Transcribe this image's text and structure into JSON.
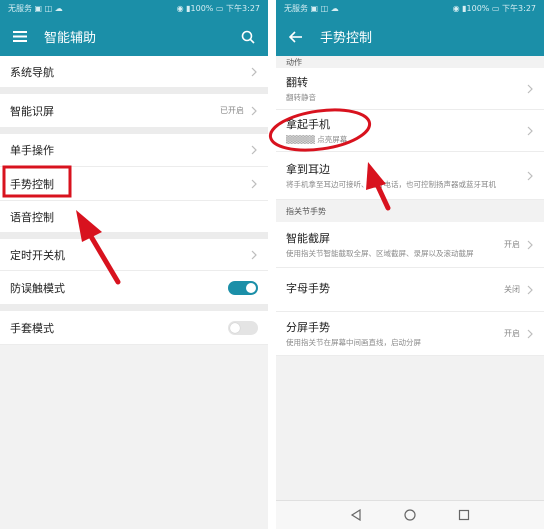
{
  "left": {
    "status": {
      "left": "无服务 ▣ ◫ ☁",
      "right": "◉ ▮100% ▭ 下午3:27"
    },
    "appbar": {
      "title": "智能辅助"
    },
    "items": [
      {
        "label": "系统导航"
      },
      {
        "label": "智能识屏",
        "value": "已开启"
      },
      {
        "label": "单手操作"
      },
      {
        "label": "手势控制"
      },
      {
        "label": "语音控制"
      },
      {
        "label": "定时开关机"
      },
      {
        "label": "防误触模式"
      },
      {
        "label": "手套模式"
      }
    ]
  },
  "right": {
    "status": {
      "left": "无服务 ▣ ◫ ☁",
      "right": "◉ ▮100% ▭ 下午3:27"
    },
    "appbar": {
      "title": "手势控制"
    },
    "section_action": "动作",
    "actions": [
      {
        "title": "翻转",
        "subtitle": "翻转静音"
      },
      {
        "title": "拿起手机",
        "subtitle": "▒▒▒▒▒ 点亮屏幕"
      },
      {
        "title": "拿到耳边",
        "subtitle": "将手机拿至耳边可接听、拨打电话，也可控制扬声器或蓝牙耳机"
      }
    ],
    "section_knuckle": "指关节手势",
    "knuckle": [
      {
        "title": "智能截屏",
        "subtitle": "使用指关节智能截取全屏、区域截屏、录屏以及滚动截屏",
        "value": "开启"
      },
      {
        "title": "字母手势",
        "subtitle": "",
        "value": "关闭"
      },
      {
        "title": "分屏手势",
        "subtitle": "使用指关节在屏幕中间画直线，启动分屏",
        "value": "开启"
      }
    ]
  },
  "colors": {
    "accent": "#1b8fa8",
    "highlight": "#d8121e"
  }
}
